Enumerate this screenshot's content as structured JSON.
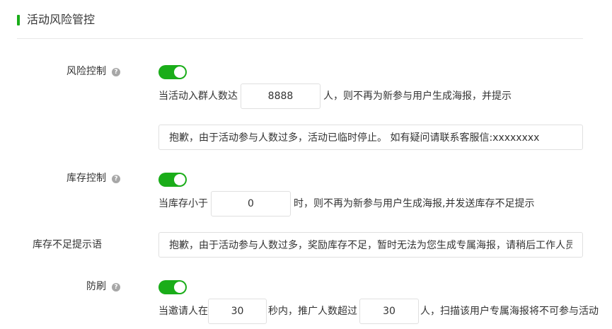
{
  "section": {
    "title": "活动风险管控"
  },
  "risk_control": {
    "label": "风险控制",
    "enabled": true,
    "text_before": "当活动入群人数达",
    "threshold_value": "8888",
    "text_after": "人，则不再为新参与用户生成海报，并提示",
    "message_value": "抱歉，由于活动参与人数过多，活动已临时停止。 如有疑问请联系客服信:xxxxxxxx"
  },
  "stock_control": {
    "label": "库存控制",
    "enabled": true,
    "text_before": "当库存小于",
    "threshold_value": "0",
    "text_after": "时，则不再为新参与用户生成海报,并发送库存不足提示"
  },
  "stock_message": {
    "label": "库存不足提示语",
    "value": "抱歉，由于活动参与人数过多，奖励库存不足，暂时无法为您生成专属海报，请稍后工作人员"
  },
  "anti_brush": {
    "label": "防刷",
    "enabled": true,
    "text_1": "当邀请人在",
    "seconds_value": "30",
    "text_2": "秒内，推广人数超过",
    "count_value": "30",
    "text_3": "人，扫描该用户专属海报将不可参与活动"
  },
  "help_icon_glyph": "?",
  "colors": {
    "accent": "#1aad19",
    "help_icon": "#a7a7a7",
    "border": "#e0e0e0"
  }
}
